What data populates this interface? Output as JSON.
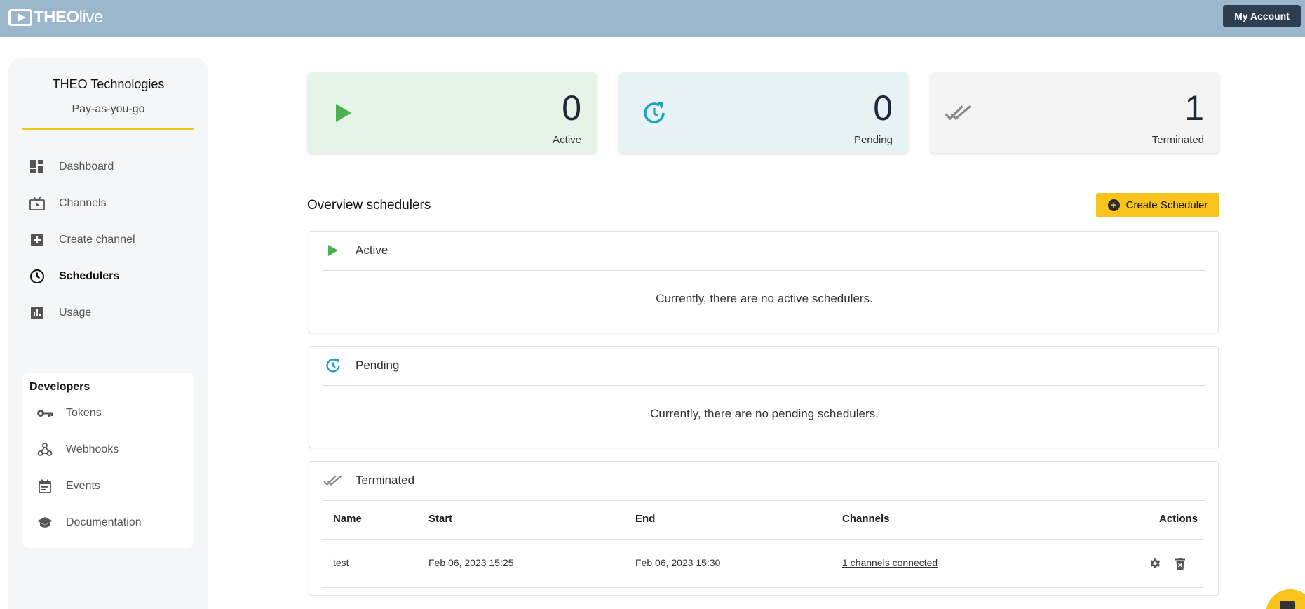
{
  "topbar": {
    "logo_text_bold": "THEO",
    "logo_text_light": "live",
    "account_label": "My Account"
  },
  "sidebar": {
    "org_name": "THEO Technologies",
    "org_plan": "Pay-as-you-go",
    "items": [
      {
        "label": "Dashboard",
        "icon": "dashboard-icon"
      },
      {
        "label": "Channels",
        "icon": "tv-icon"
      },
      {
        "label": "Create channel",
        "icon": "add-box-icon"
      },
      {
        "label": "Schedulers",
        "icon": "clock-icon",
        "active": true
      },
      {
        "label": "Usage",
        "icon": "bar-chart-icon"
      }
    ],
    "developers": {
      "title": "Developers",
      "items": [
        {
          "label": "Tokens",
          "icon": "key-icon"
        },
        {
          "label": "Webhooks",
          "icon": "webhook-icon"
        },
        {
          "label": "Events",
          "icon": "calendar-icon"
        },
        {
          "label": "Documentation",
          "icon": "school-icon"
        }
      ]
    }
  },
  "stats": {
    "active": {
      "value": "0",
      "label": "Active",
      "color": "#e6f4e7",
      "icon_color": "#4caf50"
    },
    "pending": {
      "value": "0",
      "label": "Pending",
      "color": "#e6f2f4",
      "icon_color": "#1aa3c3"
    },
    "terminated": {
      "value": "1",
      "label": "Terminated",
      "color": "#f3f3f3",
      "icon_color": "#8a8a8a"
    }
  },
  "overview": {
    "title": "Overview schedulers",
    "create_label": "Create Scheduler"
  },
  "panels": {
    "active": {
      "title": "Active",
      "empty": "Currently, there are no active schedulers."
    },
    "pending": {
      "title": "Pending",
      "empty": "Currently, there are no pending schedulers."
    },
    "terminated": {
      "title": "Terminated",
      "columns": [
        "Name",
        "Start",
        "End",
        "Channels",
        "Actions"
      ],
      "rows": [
        {
          "name": "test",
          "start": "Feb 06, 2023 15:25",
          "end": "Feb 06, 2023 15:30",
          "channels": "1 channels connected"
        }
      ]
    }
  }
}
